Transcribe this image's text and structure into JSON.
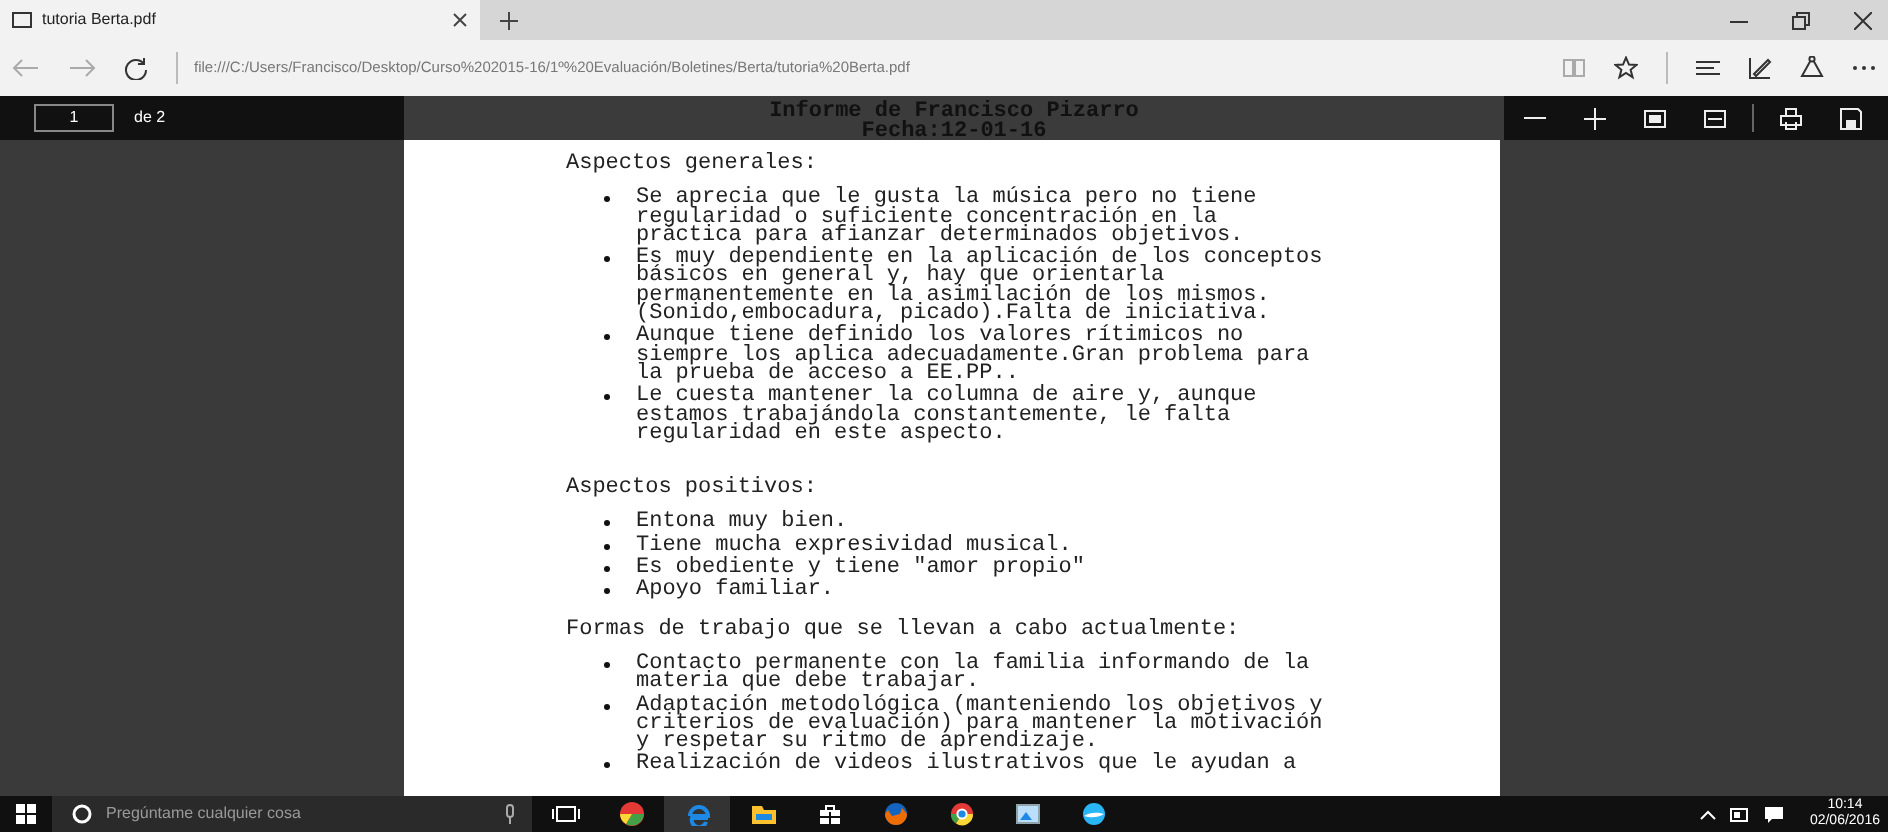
{
  "tab": {
    "title": "tutoria Berta.pdf"
  },
  "address_bar": {
    "url": "file:///C:/Users/Francisco/Desktop/Curso%202015-16/1º%20Evaluación/Boletines/Berta/tutoria%20Berta.pdf"
  },
  "pdf_toolbar": {
    "page": "1",
    "page_count": "de 2"
  },
  "document": {
    "title_lines": [
      "Informe de Francisco Pizarro",
      "Fecha:12-01-16"
    ],
    "sections": [
      {
        "heading": "Aspectos generales:",
        "items": [
          "Se aprecia que le gusta la música pero no tiene regularidad o suficiente concentración en la práctica para afianzar determinados objetivos.",
          "Es muy dependiente en la aplicación de los conceptos básicos en general y, hay que orientarla permanentemente en la asimilación de los mismos. (Sonido,embocadura, picado).Falta de iniciativa.",
          "Aunque tiene definido los valores rítimicos no siempre los aplica adecuadamente.Gran problema para la prueba de acceso a EE.PP..",
          "Le cuesta mantener la columna de aire y, aunque estamos trabajándola constantemente, le falta regularidad en este aspecto."
        ]
      },
      {
        "heading": "Aspectos positivos:",
        "items": [
          "Entona muy bien.",
          "Tiene mucha expresividad musical.",
          "Es obediente y tiene \"amor propio\"",
          "Apoyo familiar."
        ]
      },
      {
        "heading": "Formas de trabajo que se llevan a cabo actualmente:",
        "items": [
          "Contacto permanente con la familia informando de la materia que debe trabajar.",
          "Adaptación metodológica (manteniendo los objetivos y criterios de evaluación) para mantener la motivación y respetar su ritmo de aprendizaje.",
          "Realización de videos ilustrativos que le ayudan a"
        ]
      }
    ]
  },
  "taskbar": {
    "search_placeholder": "Pregúntame cualquier cosa",
    "time": "10:14",
    "date": "02/06/2016"
  }
}
